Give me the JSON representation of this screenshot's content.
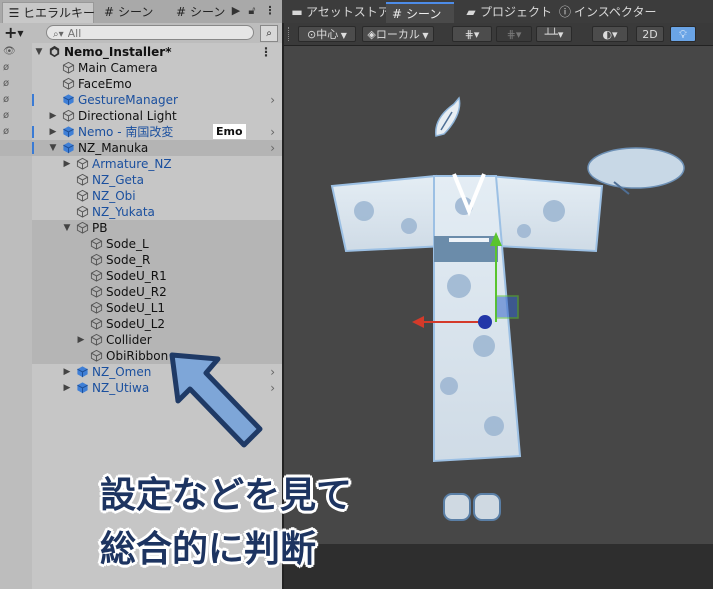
{
  "hierarchy_tabs": {
    "hierarchy": "ヒエラルキー",
    "scene1": "シーン",
    "scene2": "シーン"
  },
  "scene_tabs": {
    "asset_store": "アセットストア",
    "scene": "シーン",
    "project": "プロジェクト",
    "inspector": "インスペクター"
  },
  "hierarchy_toolbar": {
    "add": "+",
    "search_placeholder": "All"
  },
  "hierarchy": {
    "root": "Nemo_Installer*",
    "children": [
      {
        "label": "Main Camera"
      },
      {
        "label": "FaceEmo"
      },
      {
        "label": "GestureManager"
      },
      {
        "label": "Directional Light"
      },
      {
        "label": "Nemo - 南国改変",
        "tag": "Emo"
      },
      {
        "label": "NZ_Manuka"
      },
      {
        "label": "Armature_NZ"
      },
      {
        "label": "NZ_Geta"
      },
      {
        "label": "NZ_Obi"
      },
      {
        "label": "NZ_Yukata"
      },
      {
        "label": "PB"
      },
      {
        "label": "Sode_L"
      },
      {
        "label": "Sode_R"
      },
      {
        "label": "SodeU_R1"
      },
      {
        "label": "SodeU_R2"
      },
      {
        "label": "SodeU_L1"
      },
      {
        "label": "SodeU_L2"
      },
      {
        "label": "Collider"
      },
      {
        "label": "ObiRibbon"
      },
      {
        "label": "NZ_Omen"
      },
      {
        "label": "NZ_Utiwa"
      }
    ]
  },
  "scene_toolbar": {
    "pivot": "中心",
    "space": "ローカル",
    "mode_2d": "2D"
  },
  "caption": {
    "line1": "設定などを見て",
    "line2": "総合的に判断"
  },
  "colors": {
    "accent": "#4d8ce8",
    "caption_text": "#1d3461",
    "arrow_fill": "#7ea6d8",
    "arrow_stroke": "#1f3a66",
    "prefab_blue": "#1a4f9e"
  }
}
